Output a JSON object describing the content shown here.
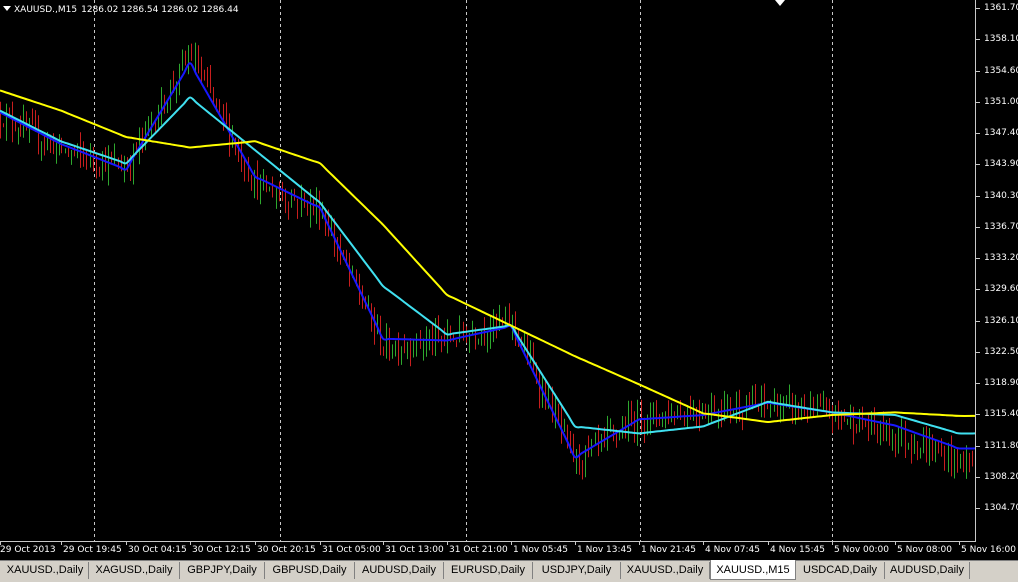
{
  "chart_header": {
    "symbol": "XAUUSD.,M15",
    "ohlc": "1286.02 1286.54 1286.02 1286.44"
  },
  "colors": {
    "background": "#000000",
    "bull_candle": "#2ea82e",
    "bear_candle": "#c81e1e",
    "ma_fast": "#1818ff",
    "ma_mid": "#40e0f0",
    "ma_slow": "#ffff00",
    "grid": "#c8c8c8"
  },
  "tabs": [
    {
      "label": "XAUUSD.,Daily"
    },
    {
      "label": "XAGUSD.,Daily"
    },
    {
      "label": "GBPJPY,Daily"
    },
    {
      "label": "GBPUSD,Daily"
    },
    {
      "label": "AUDUSD,Daily"
    },
    {
      "label": "EURUSD,Daily"
    },
    {
      "label": "USDJPY,Daily"
    },
    {
      "label": "XAUUSD.,Daily"
    },
    {
      "label": "XAUUSD.,M15",
      "active": true
    },
    {
      "label": "USDCAD,Daily"
    },
    {
      "label": "AUDUSD,Daily"
    }
  ],
  "chart_data": {
    "type": "candlestick",
    "y_axis": {
      "ticks": [
        "1361.70",
        "1358.10",
        "1354.60",
        "1351.00",
        "1347.40",
        "1343.90",
        "1340.30",
        "1336.70",
        "1333.20",
        "1329.60",
        "1326.10",
        "1322.50",
        "1318.90",
        "1315.40",
        "1311.80",
        "1308.20",
        "1304.70"
      ],
      "range": [
        1304.7,
        1361.7
      ]
    },
    "x_axis": {
      "ticks": [
        "29 Oct 2013",
        "29 Oct 19:45",
        "30 Oct 04:15",
        "30 Oct 12:15",
        "30 Oct 20:15",
        "31 Oct 05:00",
        "31 Oct 13:00",
        "31 Oct 21:00",
        "1 Nov 05:45",
        "1 Nov 13:45",
        "1 Nov 21:45",
        "4 Nov 07:45",
        "4 Nov 15:45",
        "5 Nov 00:00",
        "5 Nov 08:00",
        "5 Nov 16:00"
      ],
      "day_separators": [
        "30 Oct",
        "31 Oct",
        "1 Nov",
        "4 Nov",
        "5 Nov"
      ]
    },
    "series": [
      {
        "name": "",
        "kind": "close_path",
        "x": [
          "29 Oct 2013",
          "29 Oct 19:45",
          "30 Oct 04:15",
          "30 Oct 12:15",
          "30 Oct 20:15",
          "31 Oct 05:00",
          "31 Oct 13:00",
          "31 Oct 21:00",
          "1 Nov 05:45",
          "1 Nov 13:45",
          "1 Nov 21:45",
          "4 Nov 07:45",
          "4 Nov 15:45",
          "5 Nov 00:00",
          "5 Nov 08:00",
          "5 Nov 16:00"
        ],
        "values": [
          1349.5,
          1345.5,
          1343.5,
          1356.5,
          1341.5,
          1338.8,
          1323.0,
          1324.0,
          1326.0,
          1310.0,
          1315.0,
          1316.0,
          1316.5,
          1315.5,
          1313.0,
          1310.0
        ]
      },
      {
        "name": "",
        "kind": "ma_fast",
        "color": "#1818ff",
        "values": [
          1349.8,
          1346.2,
          1343.3,
          1355.4,
          1342.5,
          1338.9,
          1324.0,
          1323.8,
          1325.4,
          1310.5,
          1314.8,
          1315.3,
          1316.7,
          1315.6,
          1314.1,
          1311.5
        ]
      },
      {
        "name": "",
        "kind": "ma_mid",
        "color": "#40e0f0",
        "values": [
          1350.0,
          1346.5,
          1344.0,
          1351.5,
          1345.5,
          1339.5,
          1330.0,
          1324.5,
          1325.5,
          1314.0,
          1313.2,
          1314.0,
          1316.8,
          1315.6,
          1315.3,
          1313.2
        ]
      },
      {
        "name": "",
        "kind": "ma_slow",
        "color": "#ffff00",
        "values": [
          1352.3,
          1350.0,
          1347.0,
          1345.8,
          1346.5,
          1344.0,
          1337.0,
          1329.0,
          1325.5,
          1322.0,
          1318.8,
          1315.5,
          1314.5,
          1315.3,
          1315.6,
          1315.2
        ]
      }
    ]
  }
}
